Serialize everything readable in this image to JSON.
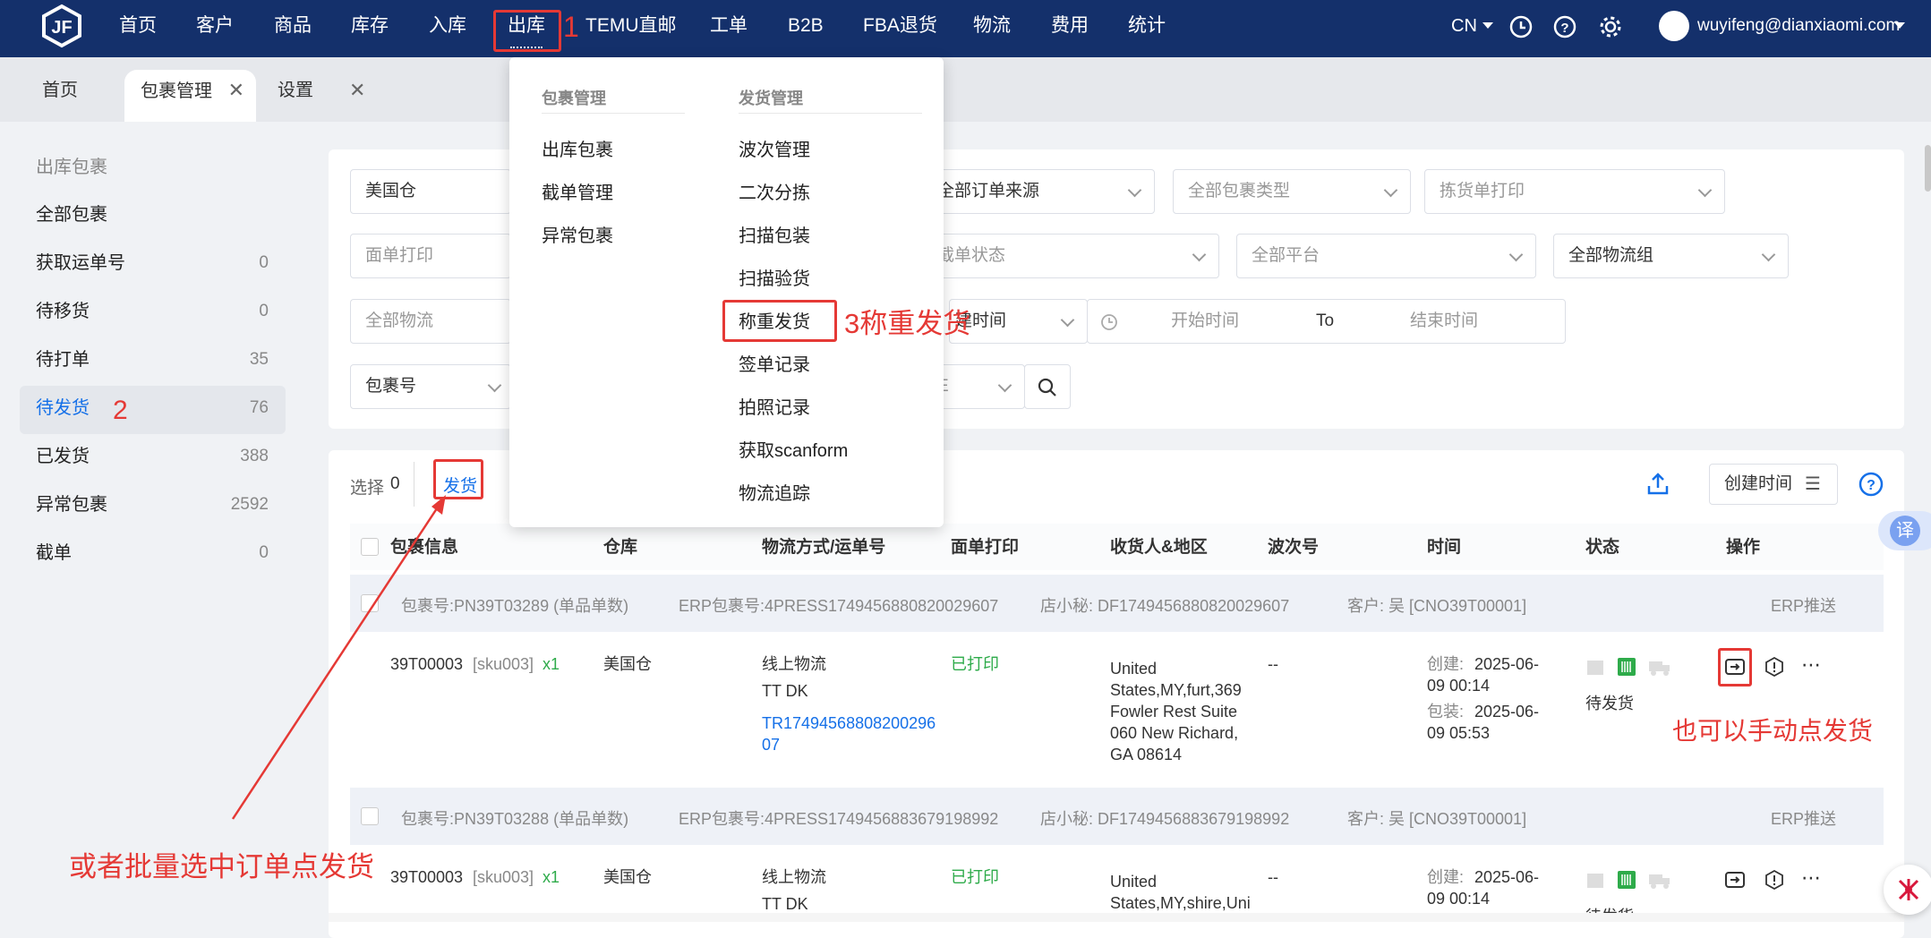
{
  "topnav": {
    "items": [
      "首页",
      "客户",
      "商品",
      "库存",
      "入库",
      "出库",
      "TEMU直邮",
      "工单",
      "B2B",
      "FBA退货",
      "物流",
      "费用",
      "统计"
    ],
    "active": "出库",
    "lang": "CN",
    "user": "wuyifeng@dianxiaomi.com"
  },
  "tabs": {
    "home": "首页",
    "package": "包裹管理",
    "settings": "设置",
    "close": "✕"
  },
  "sidebar": {
    "header": "出库包裹",
    "items": [
      {
        "label": "全部包裹",
        "count": ""
      },
      {
        "label": "获取运单号",
        "count": "0"
      },
      {
        "label": "待移货",
        "count": "0"
      },
      {
        "label": "待打单",
        "count": "35"
      },
      {
        "label": "待发货",
        "count": "76"
      },
      {
        "label": "已发货",
        "count": "388"
      },
      {
        "label": "异常包裹",
        "count": "2592"
      },
      {
        "label": "截单",
        "count": "0"
      }
    ]
  },
  "filters": {
    "warehouse": "美国仓",
    "order_source": "全部订单来源",
    "package_type": "全部包裹类型",
    "picklist_print": "拣货单打印",
    "label_print": "面单打印",
    "waybill_status": "截单状态",
    "platform": "全部平台",
    "logistics_group": "全部物流组",
    "logistics": "全部物流",
    "time_type": "建时间",
    "start_time": "开始时间",
    "to": "To",
    "end_time": "结束时间",
    "search_type": "包裹号",
    "search_suffix": "E"
  },
  "toolbar": {
    "select_label": "选择",
    "select_count": "0",
    "ship_btn": "发货",
    "sort_btn": "创建时间"
  },
  "table": {
    "headers": [
      "包裹信息",
      "仓库",
      "物流方式/运单号",
      "面单打印",
      "收货人&地区",
      "波次号",
      "时间",
      "状态",
      "操作"
    ],
    "groups": [
      {
        "pkg": "包裹号:PN39T03289 (单品单数)",
        "erp": "ERP包裹号:4PRESS1749456880820029607",
        "shop": "店小秘:  DF1749456880820029607",
        "customer": "客户: 吴  [CNO39T00001]",
        "erp_push": "ERP推送",
        "product": "39T00003",
        "sku": "[sku003]",
        "qty": "x1",
        "warehouse": "美国仓",
        "logistics": "线上物流",
        "carrier": "TT DK",
        "tracking": "TR1749456880820029607",
        "label_status": "已打印",
        "address": "United States,MY,furt,369 Fowler Rest Suite 060 New Richard, GA 08614",
        "wave": "--",
        "created_label": "创建:",
        "created": "2025-06-09 00:14",
        "packed_label": "包装:",
        "packed": "2025-06-09 05:53",
        "status": "待发货"
      },
      {
        "pkg": "包裹号:PN39T03288 (单品单数)",
        "erp": "ERP包裹号:4PRESS1749456883679198992",
        "shop": "店小秘:  DF1749456883679198992",
        "customer": "客户: 吴  [CNO39T00001]",
        "erp_push": "ERP推送",
        "product": "39T00003",
        "sku": "[sku003]",
        "qty": "x1",
        "warehouse": "美国仓",
        "logistics": "线上物流",
        "carrier": "TT DK",
        "address": "United States,MY,shire,Uni",
        "label_status": "已打印",
        "wave": "--",
        "created_label": "创建:",
        "created": "2025-06-09 00:14",
        "status": "待发货"
      }
    ]
  },
  "dropdown": {
    "col1_header": "包裹管理",
    "col1": [
      "出库包裹",
      "截单管理",
      "异常包裹"
    ],
    "col2_header": "发货管理",
    "col2": [
      "波次管理",
      "二次分拣",
      "扫描包装",
      "扫描验货",
      "称重发货",
      "签单记录",
      "拍照记录",
      "获取scanform",
      "物流追踪"
    ]
  },
  "annotations": {
    "a1": "1",
    "a2": "2",
    "a3": "3称重发货",
    "manual": "也可以手动点发货",
    "batch": "或者批量选中订单点发货"
  },
  "side_widget": "译",
  "colors": {
    "nav": "#14306b",
    "accent": "#1570e8",
    "red": "#e53935",
    "green": "#2eab4a"
  }
}
